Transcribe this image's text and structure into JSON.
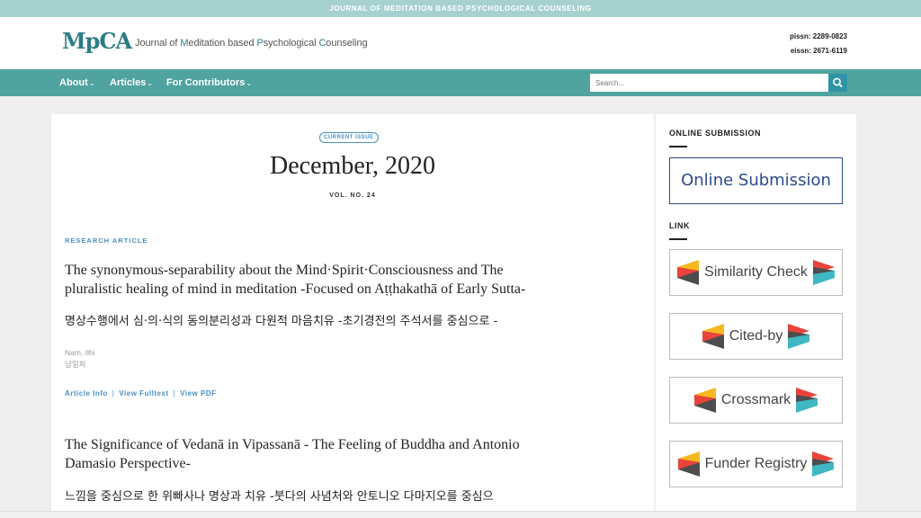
{
  "topbar": {
    "text": "JOURNAL OF MEDITATION BASED PSYCHOLOGICAL COUNSELING"
  },
  "header": {
    "logo_mark": "MpCA",
    "logo_text_parts": [
      "M",
      "editation based ",
      "P",
      "sychological ",
      "C",
      "ounseling"
    ],
    "journal_prefix": "Journal of ",
    "pissn": "pissn: 2289-0823",
    "eissn": "eissn: 2671-6119"
  },
  "nav": {
    "items": [
      {
        "label": "About"
      },
      {
        "label": "Articles"
      },
      {
        "label": "For Contributors"
      }
    ],
    "search_placeholder": "Search..."
  },
  "issue": {
    "badge": "CURRENT ISSUE",
    "title": "December, 2020",
    "vol": "VOL. NO. 24"
  },
  "articles": [
    {
      "type": "RESEARCH ARTICLE",
      "title_line1": "The synonymous-separability about the Mind·Spirit·Consciousness and The",
      "title_line2": "pluralistic healing of mind in meditation -Focused on Aṭṭhakathā of Early Sutta-",
      "title_ko": "명상수행에서 심·의·식의 동의분리성과 다원적 마음치유 -초기경전의 주석서를 중심으로 -",
      "author_en": "Nam, Ilhi",
      "author_ko": "남일희",
      "links": [
        "Article Info",
        "View Fulltext",
        "View PDF"
      ]
    },
    {
      "title_line1": "The Significance of Vedanā in Vipassanā - The Feeling of Buddha and Antonio",
      "title_line2": "Damasio Perspective-",
      "title_ko": "느낌을 중심으로 한 위빠사나 명상과 치유 -붓다의 사념처와 안토니오 다마지오를 중심으"
    }
  ],
  "sidebar": {
    "online_heading": "ONLINE SUBMISSION",
    "online_button": "Online Submission",
    "link_heading": "LINK",
    "links": [
      {
        "label": "Similarity Check"
      },
      {
        "label": "Cited-by"
      },
      {
        "label": "Crossmark"
      },
      {
        "label": "Funder Registry"
      }
    ],
    "colors": {
      "yellow": "#f5b91f",
      "red": "#e8443a",
      "teal": "#3fb8c4",
      "gray": "#4d4d4f"
    }
  }
}
